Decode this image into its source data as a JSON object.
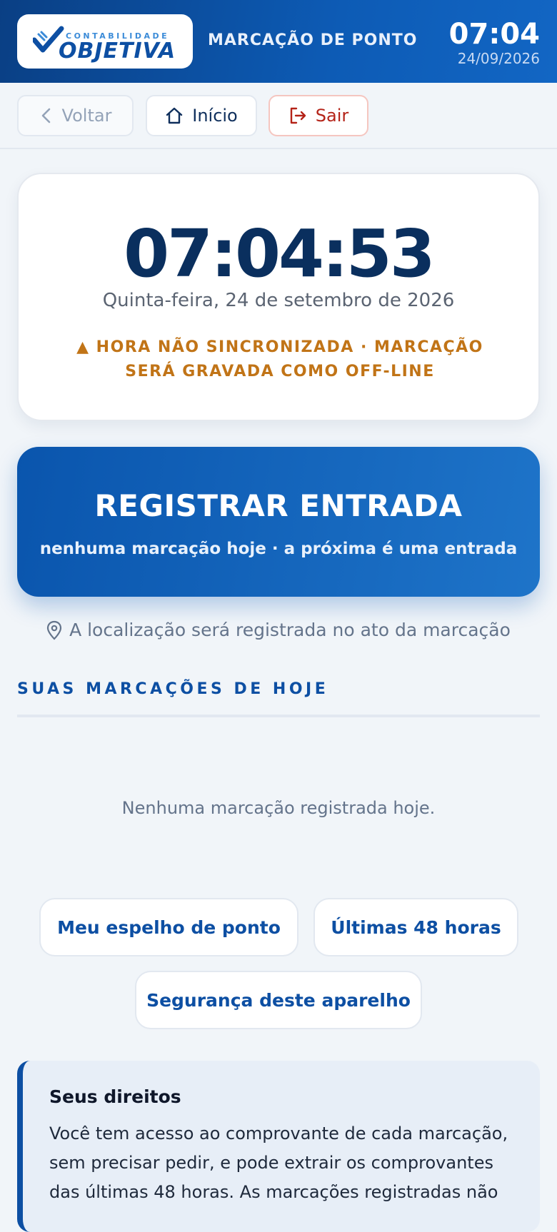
{
  "header": {
    "logo_small": "CONTABILIDADE",
    "logo_big": "OBJETIVA",
    "title": "MARCAÇÃO DE PONTO",
    "time": "07:04",
    "date": "24/09/2026"
  },
  "nav": {
    "back_label": "Voltar",
    "home_label": "Início",
    "exit_label": "Sair"
  },
  "clock": {
    "time": "07:04:53",
    "date_long": "Quinta-feira, 24 de setembro de 2026",
    "warning": "▲ HORA NÃO SINCRONIZADA · MARCAÇÃO SERÁ GRAVADA COMO OFF-LINE"
  },
  "register": {
    "title": "REGISTRAR ENTRADA",
    "subtitle": "nenhuma marcação hoje · a próxima é uma entrada"
  },
  "location_note": "A localização será registrada no ato da marcação",
  "today": {
    "section_title": "SUAS MARCAÇÕES DE HOJE",
    "empty_message": "Nenhuma marcação registrada hoje."
  },
  "links": {
    "mirror": "Meu espelho de ponto",
    "last48": "Últimas 48 horas",
    "security": "Segurança deste aparelho"
  },
  "rights": {
    "title": "Seus direitos",
    "text": "Você tem acesso ao comprovante de cada marcação, sem precisar pedir, e pode extrair os comprovantes das últimas 48 horas. As marcações registradas não"
  },
  "colors": {
    "header_start": "#0a3f84",
    "header_end": "#1266c4",
    "primary": "#0d4fa3",
    "warning": "#c17417",
    "exit": "#b42318"
  },
  "icons": {
    "back": "chevron-left-icon",
    "home": "home-icon",
    "exit": "logout-icon",
    "location": "map-pin-icon"
  }
}
